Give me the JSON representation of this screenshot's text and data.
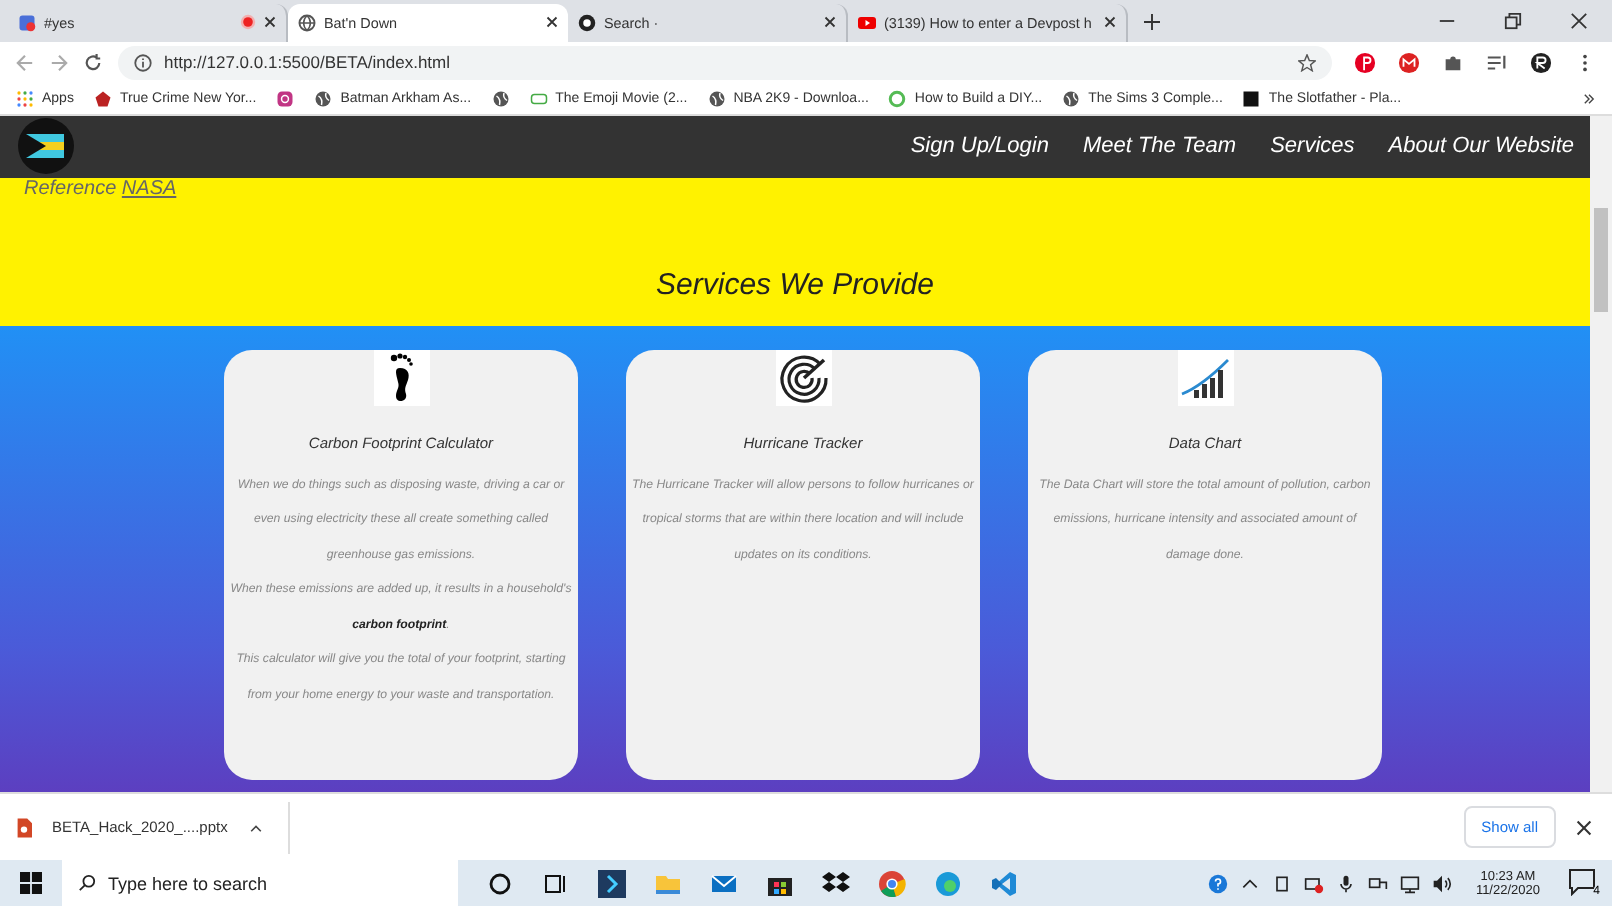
{
  "tabs": [
    {
      "title": "#yes",
      "selected": false,
      "recording": true,
      "kind": "app"
    },
    {
      "title": "Bat'n Down",
      "selected": true,
      "recording": false,
      "kind": "globe"
    },
    {
      "title": "Search ·",
      "selected": false,
      "recording": false,
      "kind": "github"
    },
    {
      "title": "(3139) How to enter a Devpost h",
      "selected": false,
      "recording": false,
      "kind": "youtube"
    }
  ],
  "address": "http://127.0.0.1:5500/BETA/index.html",
  "bookmarks": [
    {
      "label": "Apps",
      "kind": "apps"
    },
    {
      "label": "True Crime New Yor...",
      "kind": "red"
    },
    {
      "kind": "instagram"
    },
    {
      "label": "Batman Arkham As...",
      "kind": "globe"
    },
    {
      "kind": "globe"
    },
    {
      "label": "The Emoji Movie (2...",
      "kind": "green"
    },
    {
      "label": "NBA 2K9 - Downloa...",
      "kind": "globe"
    },
    {
      "label": "How to Build a DIY...",
      "kind": "leaf"
    },
    {
      "label": "The Sims 3 Comple...",
      "kind": "globe"
    },
    {
      "label": "The Slotfather - Pla...",
      "kind": "dark"
    }
  ],
  "nav": {
    "links": [
      "Sign Up/Login",
      "Meet The Team",
      "Services",
      "About Our Website"
    ]
  },
  "reference": {
    "label": "Reference",
    "link": "NASA"
  },
  "services": {
    "title": "Services We Provide",
    "cards": [
      {
        "kind": "footprint",
        "title": "Carbon Footprint Calculator",
        "paragraphs": [
          "When we do things such as disposing waste, driving a car or even using electricity these all create something called greenhouse gas emissions.",
          "When these emissions are added up, it results in a household's **carbon footprint**.",
          "This calculator will give you the total of your footprint, starting from your home energy to your waste and transportation."
        ]
      },
      {
        "kind": "hurricane",
        "title": "Hurricane Tracker",
        "paragraphs": [
          "The Hurricane Tracker will allow persons to follow hurricanes or tropical storms that are within there location and will include updates on its conditions."
        ]
      },
      {
        "kind": "chart",
        "title": "Data Chart",
        "paragraphs": [
          "The Data Chart will store the total amount of pollution, carbon emissions, hurricane intensity and associated amount of damage done."
        ]
      }
    ]
  },
  "download": {
    "file": "BETA_Hack_2020_....pptx",
    "show_all": "Show all"
  },
  "taskbar": {
    "search_placeholder": "Type here to search",
    "time": "10:23 AM",
    "date": "11/22/2020",
    "notifications": "4"
  }
}
